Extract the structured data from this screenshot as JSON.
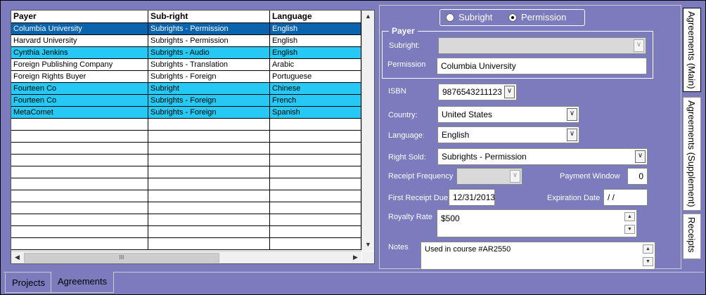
{
  "table": {
    "columns": [
      "Payer",
      "Sub-right",
      "Language"
    ],
    "rows": [
      {
        "payer": "Columbia University",
        "subright": "Subrights - Permission",
        "language": "English"
      },
      {
        "payer": "Harvard University",
        "subright": "Subrights - Permission",
        "language": "English"
      },
      {
        "payer": "Cynthia Jenkins",
        "subright": "Subrights - Audio",
        "language": "English"
      },
      {
        "payer": "Foreign Publishing Company",
        "subright": "Subrights - Translation",
        "language": "Arabic"
      },
      {
        "payer": "Foreign Rights Buyer",
        "subright": "Subrights - Foreign",
        "language": "Portuguese"
      },
      {
        "payer": "Fourteen Co",
        "subright": "Subright",
        "language": "Chinese"
      },
      {
        "payer": "Fourteen Co",
        "subright": "Subrights - Foreign",
        "language": "French"
      },
      {
        "payer": "MetaComet",
        "subright": "Subrights - Foreign",
        "language": "Spanish"
      }
    ],
    "selected_row": 0,
    "highlighted_rows": [
      2,
      5,
      6,
      7
    ],
    "scroll_thumb": "III"
  },
  "mode": {
    "subright_label": "Subright",
    "permission_label": "Permission",
    "selected": "Permission"
  },
  "payer": {
    "legend": "Payer",
    "subright_label": "Subright:",
    "subright_value": "",
    "permission_label": "Permission",
    "permission_value": "Columbia University"
  },
  "form": {
    "isbn_label": "ISBN",
    "isbn_value": "9876543211123",
    "country_label": "Country:",
    "country_value": "United States",
    "language_label": "Language:",
    "language_value": "English",
    "right_sold_label": "Right Sold:",
    "right_sold_value": "Subrights - Permission",
    "receipt_frequency_label": "Receipt Frequency",
    "receipt_frequency_value": "",
    "payment_window_label": "Payment Window",
    "payment_window_value": "0",
    "first_receipt_due_label": "First Receipt Due",
    "first_receipt_due_value": "12/31/2013",
    "expiration_date_label": "Expiration Date",
    "expiration_date_value": " / /",
    "royalty_rate_label": "Royalty Rate",
    "royalty_rate_value": "$500",
    "notes_label": "Notes",
    "notes_value": "Used in course #AR2550"
  },
  "side_tabs": [
    "Agreements (Main)",
    "Agreements (Supplement)",
    "Receipts"
  ],
  "bottom_tabs": [
    "Projects",
    "Agreements"
  ],
  "colors": {
    "background": "#7b7bbd",
    "row_highlight": "#26c9f3",
    "row_selected": "#0a64ad"
  }
}
